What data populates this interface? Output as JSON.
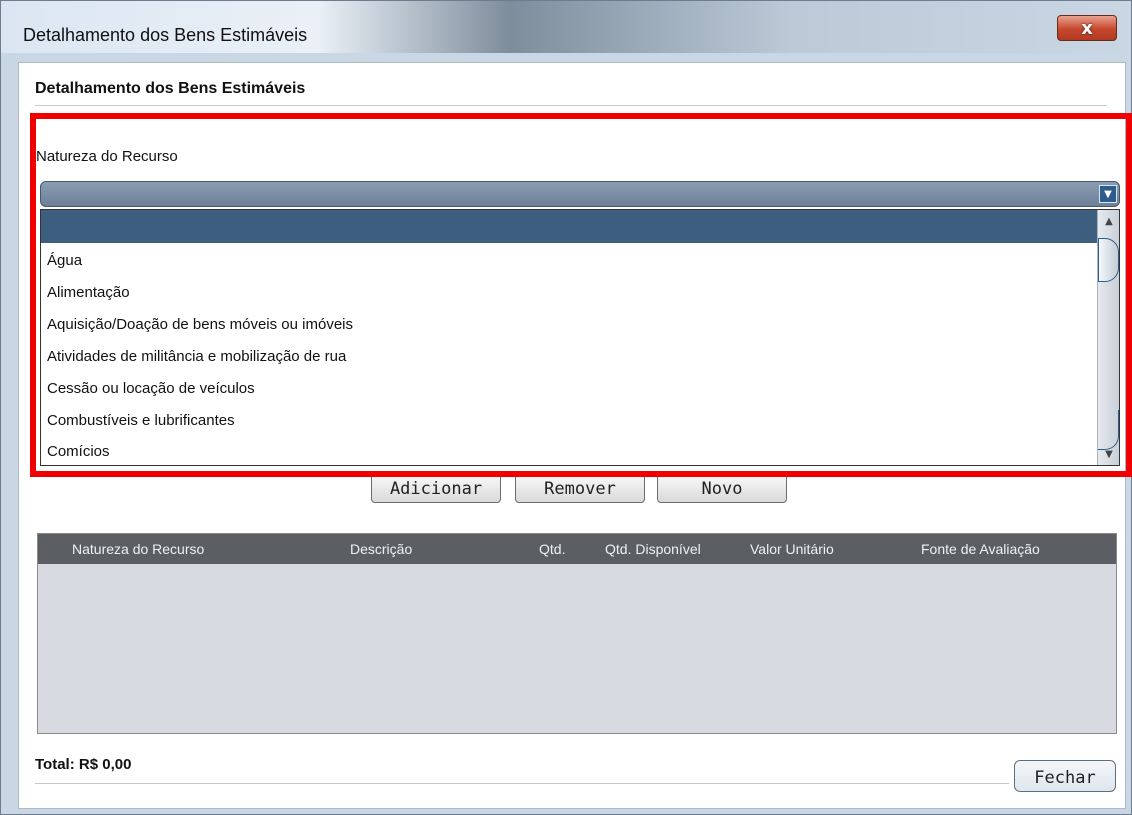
{
  "window": {
    "title": "Detalhamento dos Bens Estimáveis",
    "close_label": "x"
  },
  "panel": {
    "title": "Detalhamento dos Bens Estimáveis"
  },
  "nature_field": {
    "label": "Natureza do Recurso",
    "selected_value": "",
    "options": [
      "",
      "Água",
      "Alimentação",
      "Aquisição/Doação de bens móveis ou imóveis",
      "Atividades de militância e mobilização de rua",
      "Cessão ou locação de veículos",
      "Combustíveis e lubrificantes",
      "Comícios"
    ]
  },
  "actions": {
    "add": "Adicionar",
    "remove": "Remover",
    "new": "Novo"
  },
  "table": {
    "columns": [
      "Natureza do Recurso",
      "Descrição",
      "Qtd.",
      "Qtd. Disponível",
      "Valor Unitário",
      "Fonte de Avaliação"
    ],
    "rows": []
  },
  "footer": {
    "total": "Total: R$  0,00",
    "close": "Fechar"
  },
  "colors": {
    "highlight": "#f00000",
    "selected_option": "#3e5e80",
    "table_header": "#5b5f63"
  }
}
